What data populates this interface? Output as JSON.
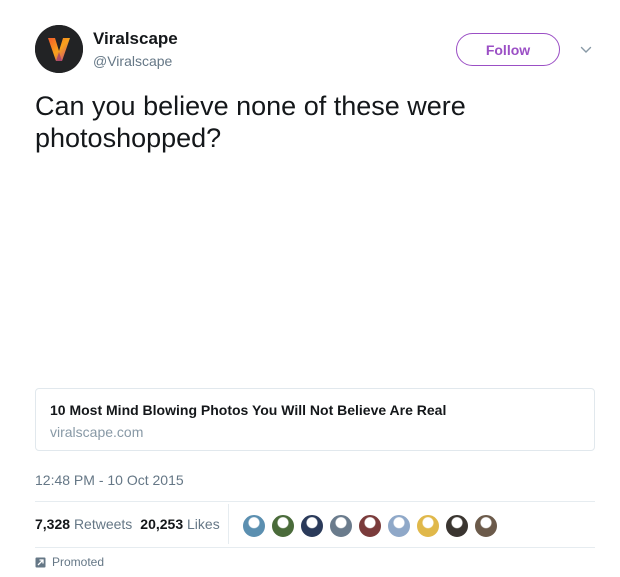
{
  "author": {
    "display_name": "Viralscape",
    "handle": "@Viralscape",
    "avatar_icon": "viralscape-v-logo",
    "avatar_bg": "#222325"
  },
  "follow_button": {
    "label": "Follow",
    "color": "#9b4fc5"
  },
  "tweet": {
    "text": "Can you believe none of these were photoshopped?",
    "timestamp": "12:48 PM - 10 Oct 2015"
  },
  "card": {
    "title": "10 Most Mind Blowing Photos You Will Not Believe Are Real",
    "domain": "viralscape.com"
  },
  "stats": {
    "retweets_count": "7,328",
    "retweets_label": "Retweets",
    "likes_count": "20,253",
    "likes_label": "Likes"
  },
  "likers": [
    {
      "icon": "user-avatar",
      "color": "#5b8fb0"
    },
    {
      "icon": "user-avatar",
      "color": "#4a6b3a"
    },
    {
      "icon": "user-avatar",
      "color": "#2a3a5a"
    },
    {
      "icon": "user-avatar",
      "color": "#6a7b8c"
    },
    {
      "icon": "user-avatar",
      "color": "#7a3b3b"
    },
    {
      "icon": "user-avatar",
      "color": "#8fa8c8"
    },
    {
      "icon": "user-avatar",
      "color": "#e0b84a"
    },
    {
      "icon": "user-avatar",
      "color": "#3a3530"
    },
    {
      "icon": "user-avatar",
      "color": "#6b5a4a"
    }
  ],
  "promoted": {
    "label": "Promoted",
    "icon": "promoted-arrow-icon"
  }
}
